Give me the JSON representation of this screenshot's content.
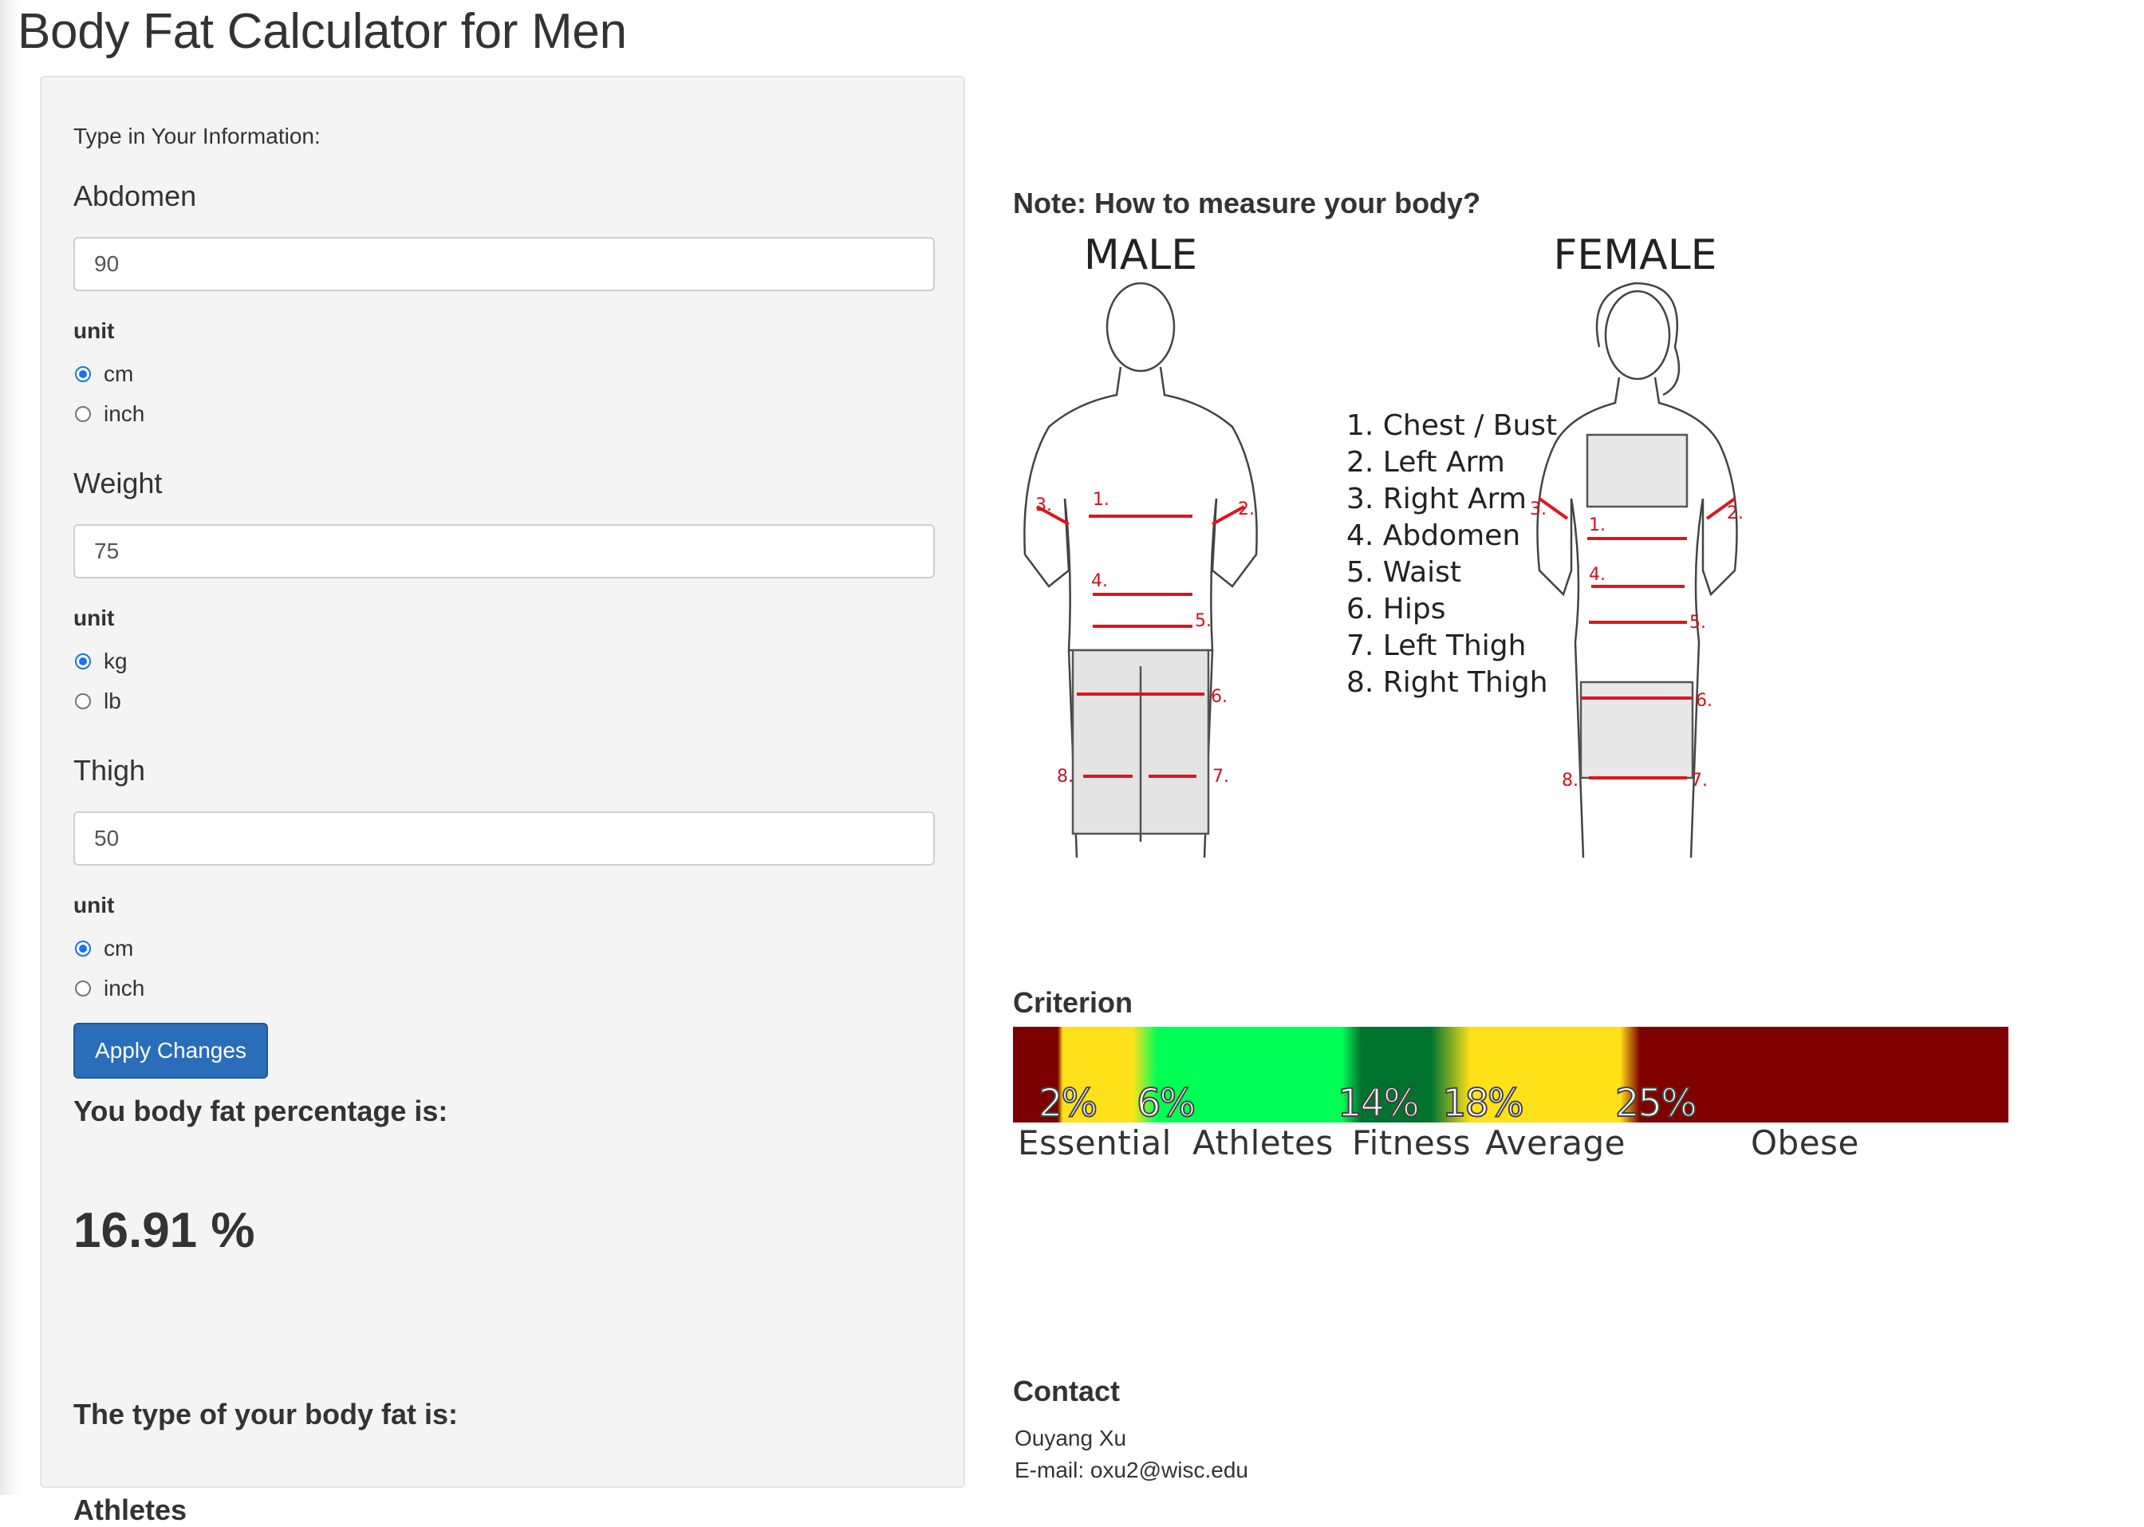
{
  "page": {
    "title": "Body Fat Calculator for Men"
  },
  "form": {
    "hint": "Type in Your Information:",
    "abdomen": {
      "label": "Abdomen",
      "value": "90",
      "unit_label": "unit",
      "options": [
        {
          "label": "cm",
          "checked": true
        },
        {
          "label": "inch",
          "checked": false
        }
      ]
    },
    "weight": {
      "label": "Weight",
      "value": "75",
      "unit_label": "unit",
      "options": [
        {
          "label": "kg",
          "checked": true
        },
        {
          "label": "lb",
          "checked": false
        }
      ]
    },
    "thigh": {
      "label": "Thigh",
      "value": "50",
      "unit_label": "unit",
      "options": [
        {
          "label": "cm",
          "checked": true
        },
        {
          "label": "inch",
          "checked": false
        }
      ]
    },
    "apply_label": "Apply Changes"
  },
  "result": {
    "percentage_label": "You body fat percentage is:",
    "percentage_value": "16.91 %",
    "type_label": "The type of your body fat is:",
    "type_value": "Athletes"
  },
  "note": {
    "title": "Note: How to measure your body?",
    "male_label": "MALE",
    "female_label": "FEMALE",
    "measurements": [
      "1. Chest / Bust",
      "2. Left Arm",
      "3. Right Arm",
      "4. Abdomen",
      "5. Waist",
      "6. Hips",
      "7. Left Thigh",
      "8. Right Thigh"
    ]
  },
  "criterion": {
    "title": "Criterion",
    "thresholds": [
      "2%",
      "6%",
      "14%",
      "18%",
      "25%"
    ],
    "categories": [
      "Essential",
      "Athletes",
      "Fitness",
      "Average",
      "Obese"
    ],
    "colors": {
      "essential": "#7d0000",
      "athletes_from": "#ffe119",
      "athletes": "#00ff55",
      "fitness": "#00732f",
      "average": "#ffe119",
      "obese": "#800000"
    }
  },
  "contact": {
    "title": "Contact",
    "name": "Ouyang Xu",
    "email": "E-mail: oxu2@wisc.edu"
  }
}
